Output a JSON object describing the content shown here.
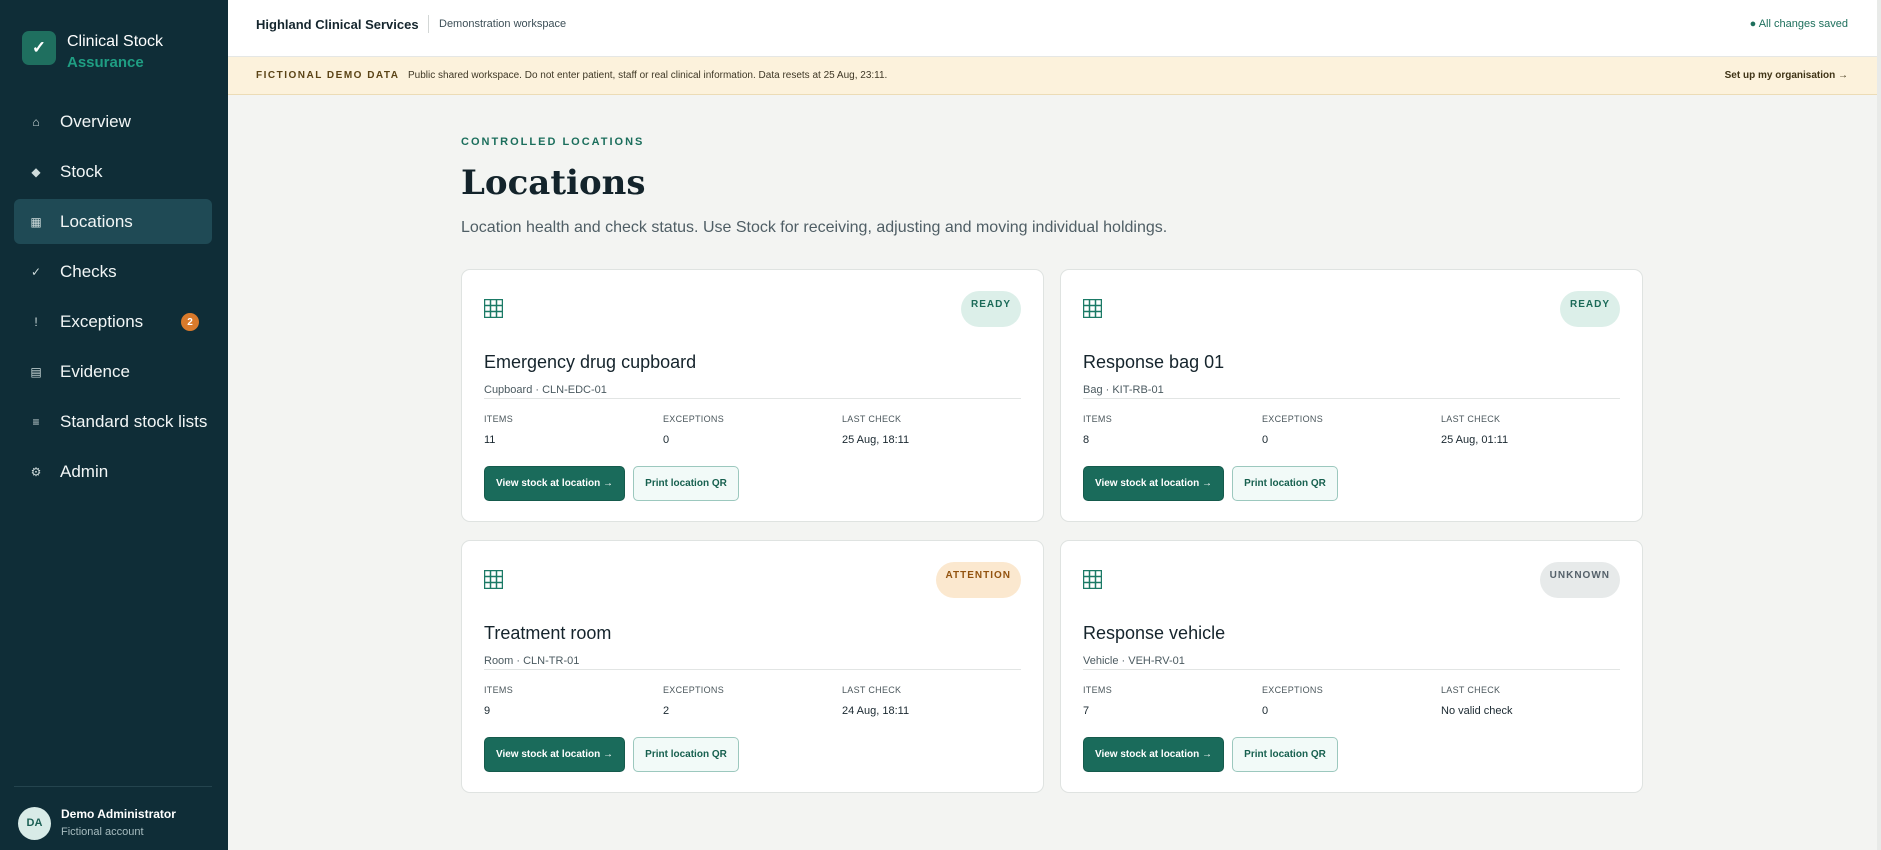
{
  "brand": {
    "mark": "✓",
    "name_line1": "Clinical Stock",
    "name_line2": "Assurance"
  },
  "nav": {
    "items": [
      {
        "icon": "⌂",
        "icon_name": "home-icon",
        "label": "Overview"
      },
      {
        "icon": "◆",
        "icon_name": "stock-diamond-icon",
        "label": "Stock"
      },
      {
        "icon": "▦",
        "icon_name": "grid-icon",
        "label": "Locations",
        "active": true
      },
      {
        "icon": "✓",
        "icon_name": "check-icon",
        "label": "Checks"
      },
      {
        "icon": "!",
        "icon_name": "exclamation-icon",
        "label": "Exceptions",
        "badge": "2"
      },
      {
        "icon": "▤",
        "icon_name": "document-icon",
        "label": "Evidence"
      },
      {
        "icon": "≡",
        "icon_name": "list-icon",
        "label": "Standard stock lists"
      },
      {
        "icon": "⚙",
        "icon_name": "gear-icon",
        "label": "Admin"
      }
    ]
  },
  "user": {
    "initials": "DA",
    "name": "Demo Administrator",
    "subtitle": "Fictional account"
  },
  "header": {
    "org": "Highland Clinical Services",
    "workspace": "Demonstration workspace",
    "save_status": "● All changes saved"
  },
  "banner": {
    "tag": "FICTIONAL DEMO DATA",
    "message": "Public shared workspace. Do not enter patient, staff or real clinical information. Data resets at 25 Aug, 23:11.",
    "link": "Set up my organisation →"
  },
  "page": {
    "eyebrow": "CONTROLLED LOCATIONS",
    "title": "Locations",
    "subtitle": "Location health and check status. Use Stock for receiving, adjusting and moving individual holdings."
  },
  "labels": {
    "items": "ITEMS",
    "exceptions": "EXCEPTIONS",
    "last_check": "LAST CHECK",
    "view_stock": "View stock at location →",
    "print_qr": "Print location QR"
  },
  "locations": [
    {
      "name": "Emergency drug cupboard",
      "meta": "Cupboard · CLN-EDC-01",
      "status": "READY",
      "items": "11",
      "exceptions": "0",
      "last_check": "25 Aug, 18:11"
    },
    {
      "name": "Response bag 01",
      "meta": "Bag · KIT-RB-01",
      "status": "READY",
      "items": "8",
      "exceptions": "0",
      "last_check": "25 Aug, 01:11"
    },
    {
      "name": "Treatment room",
      "meta": "Room · CLN-TR-01",
      "status": "ATTENTION",
      "items": "9",
      "exceptions": "2",
      "last_check": "24 Aug, 18:11"
    },
    {
      "name": "Response vehicle",
      "meta": "Vehicle · VEH-RV-01",
      "status": "UNKNOWN",
      "items": "7",
      "exceptions": "0",
      "last_check": "No valid check"
    }
  ]
}
